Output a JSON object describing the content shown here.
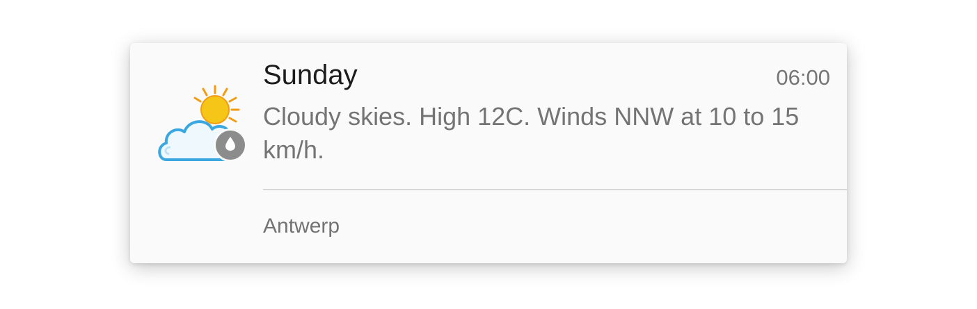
{
  "notification": {
    "title": "Sunday",
    "time": "06:00",
    "description": "Cloudy skies. High 12C. Winds NNW at 10 to 15 km/h.",
    "location": "Antwerp",
    "icons": {
      "weather": "partly-cloudy-icon",
      "badge": "raindrop-icon"
    },
    "colors": {
      "background": "#fafafa",
      "title": "#1c1c1c",
      "secondary_text": "#747474",
      "badge": "#8c8c8c",
      "sun": "#f5c518",
      "cloud_outline": "#3aa7e0"
    }
  }
}
